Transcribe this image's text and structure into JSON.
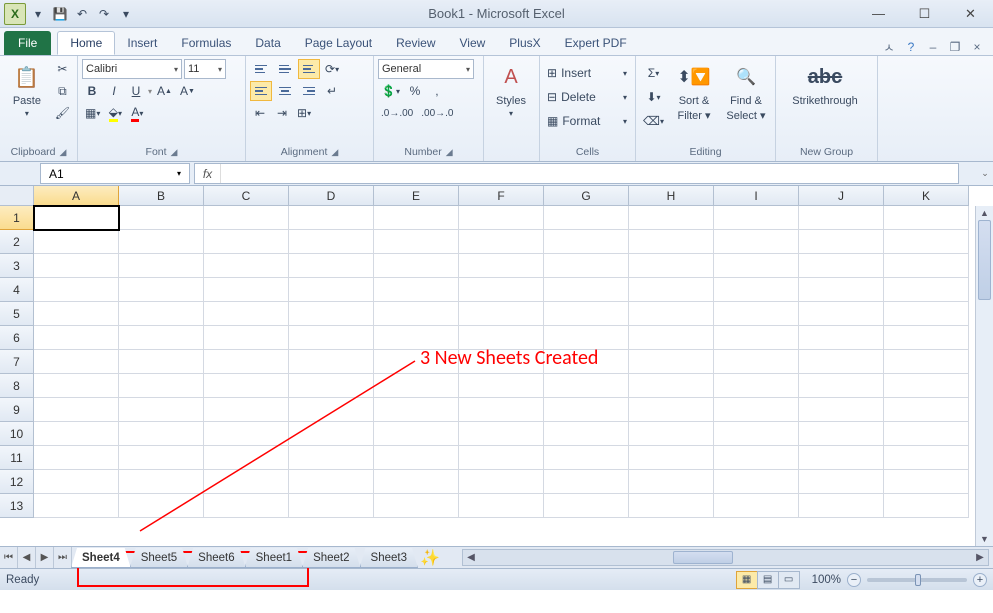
{
  "window": {
    "title": "Book1 - Microsoft Excel"
  },
  "qat": {
    "save": "💾",
    "undo": "↶",
    "redo": "↷"
  },
  "tabs": {
    "file": "File",
    "list": [
      "Home",
      "Insert",
      "Formulas",
      "Data",
      "Page Layout",
      "Review",
      "View",
      "PlusX",
      "Expert PDF"
    ],
    "active": "Home"
  },
  "ribbon": {
    "clipboard": {
      "label": "Clipboard",
      "paste": "Paste"
    },
    "font": {
      "label": "Font",
      "name": "Calibri",
      "size": "11",
      "bold": "B",
      "italic": "I",
      "underline": "U"
    },
    "alignment": {
      "label": "Alignment"
    },
    "number": {
      "label": "Number",
      "format": "General"
    },
    "styles": {
      "label": "Styles",
      "btn": "Styles"
    },
    "cells": {
      "label": "Cells",
      "insert": "Insert",
      "delete": "Delete",
      "format": "Format"
    },
    "editing": {
      "label": "Editing",
      "sort": "Sort &",
      "filter": "Filter",
      "find": "Find &",
      "select": "Select"
    },
    "newgroup": {
      "label": "New Group",
      "strike": "Strikethrough"
    }
  },
  "formula": {
    "namebox": "A1",
    "fx": "fx"
  },
  "grid": {
    "cols": [
      "A",
      "B",
      "C",
      "D",
      "E",
      "F",
      "G",
      "H",
      "I",
      "J",
      "K"
    ],
    "rows": [
      "1",
      "2",
      "3",
      "4",
      "5",
      "6",
      "7",
      "8",
      "9",
      "10",
      "11",
      "12",
      "13"
    ],
    "activeCell": "A1"
  },
  "annotation": {
    "text": "3 New Sheets Created"
  },
  "sheets": {
    "tabs": [
      "Sheet4",
      "Sheet5",
      "Sheet6",
      "Sheet1",
      "Sheet2",
      "Sheet3"
    ],
    "active": "Sheet4"
  },
  "status": {
    "ready": "Ready",
    "zoom": "100%"
  }
}
